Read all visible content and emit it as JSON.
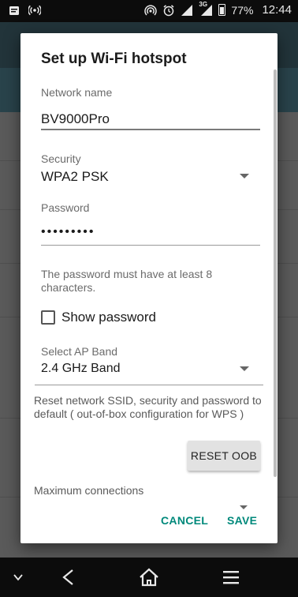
{
  "status_bar": {
    "battery": "77%",
    "time": "12:44",
    "network_type": "3G",
    "left_icons": [
      "notification-app-icon",
      "hotspot-broadcast-icon"
    ],
    "right_icons": [
      "wifi-tethering-icon",
      "alarm-icon",
      "signal-icon",
      "signal-3g-icon",
      "battery-icon"
    ]
  },
  "dialog": {
    "title": "Set up Wi-Fi hotspot",
    "network_name": {
      "label": "Network name",
      "value": "BV9000Pro"
    },
    "security": {
      "label": "Security",
      "value": "WPA2 PSK"
    },
    "password": {
      "label": "Password",
      "value": "•••••••••"
    },
    "password_hint": "The password must have at least 8 characters.",
    "show_password_label": "Show password",
    "show_password_checked": false,
    "ap_band": {
      "label": "Select AP Band",
      "value": "2.4 GHz Band"
    },
    "reset_description": "Reset network SSID, security and password to default ( out-of-box configuration for WPS )",
    "reset_button_label": "RESET OOB",
    "max_connections_label": "Maximum connections",
    "cancel_label": "CANCEL",
    "save_label": "SAVE",
    "accent_color": "#00897b"
  },
  "nav_bar": {
    "icons": [
      "chevron-down-icon",
      "back-icon",
      "home-icon",
      "recents-icon"
    ]
  }
}
